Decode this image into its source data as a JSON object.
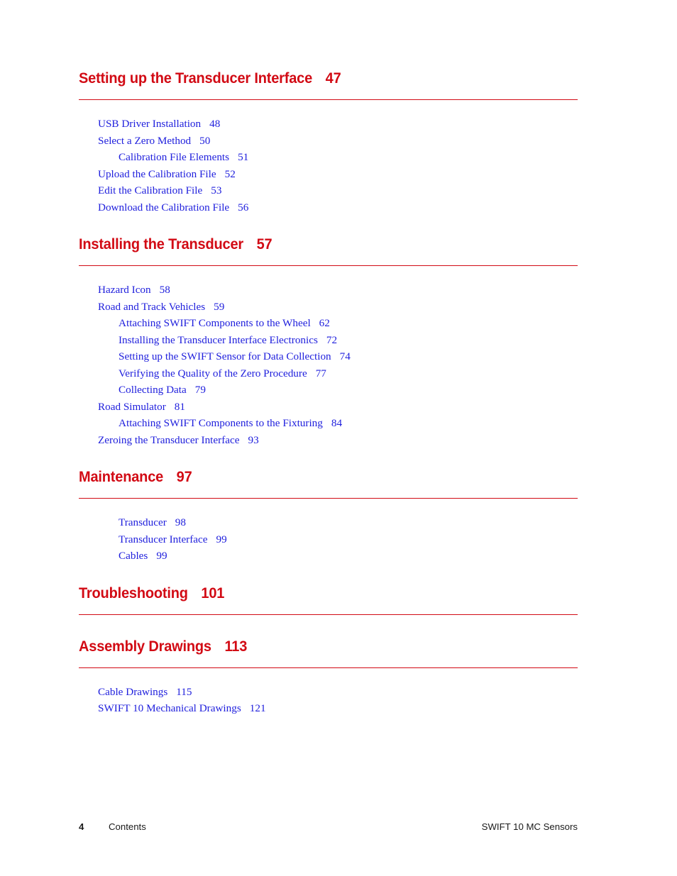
{
  "document": {
    "colors": {
      "heading_red": "#d20a14",
      "entry_blue": "#2020dd",
      "footer_text": "#1a1a1a",
      "background": "#ffffff"
    }
  },
  "toc": {
    "sections": [
      {
        "title": "Setting up the Transducer Interface",
        "page": "47",
        "entries": [
          {
            "label": "USB Driver Installation",
            "page": "48",
            "level": 1
          },
          {
            "label": "Select a Zero Method",
            "page": "50",
            "level": 1
          },
          {
            "label": "Calibration File Elements",
            "page": "51",
            "level": 2
          },
          {
            "label": "Upload the Calibration File",
            "page": "52",
            "level": 1
          },
          {
            "label": "Edit the Calibration File",
            "page": "53",
            "level": 1
          },
          {
            "label": "Download the Calibration File",
            "page": "56",
            "level": 1
          }
        ]
      },
      {
        "title": "Installing the Transducer",
        "page": "57",
        "entries": [
          {
            "label": "Hazard Icon",
            "page": "58",
            "level": 1
          },
          {
            "label": "Road and Track Vehicles",
            "page": "59",
            "level": 1
          },
          {
            "label": "Attaching SWIFT Components to the Wheel",
            "page": "62",
            "level": 2
          },
          {
            "label": "Installing the Transducer Interface Electronics",
            "page": "72",
            "level": 2
          },
          {
            "label": "Setting up the SWIFT Sensor for Data Collection",
            "page": "74",
            "level": 2
          },
          {
            "label": "Verifying the Quality of the Zero Procedure",
            "page": "77",
            "level": 2
          },
          {
            "label": "Collecting Data",
            "page": "79",
            "level": 2
          },
          {
            "label": "Road Simulator",
            "page": "81",
            "level": 1
          },
          {
            "label": "Attaching SWIFT Components to the Fixturing",
            "page": "84",
            "level": 2
          },
          {
            "label": "Zeroing the Transducer Interface",
            "page": "93",
            "level": 1
          }
        ]
      },
      {
        "title": "Maintenance",
        "page": "97",
        "entries": [
          {
            "label": "Transducer",
            "page": "98",
            "level": 2
          },
          {
            "label": "Transducer Interface",
            "page": "99",
            "level": 2
          },
          {
            "label": "Cables",
            "page": "99",
            "level": 2
          }
        ]
      },
      {
        "title": "Troubleshooting",
        "page": "101",
        "entries": []
      },
      {
        "title": "Assembly Drawings",
        "page": "113",
        "entries": [
          {
            "label": "Cable Drawings",
            "page": "115",
            "level": 1
          },
          {
            "label": "SWIFT 10 Mechanical Drawings",
            "page": "121",
            "level": 1
          }
        ]
      }
    ]
  },
  "footer": {
    "page_number": "4",
    "left_label": "Contents",
    "right_label": "SWIFT 10 MC Sensors"
  }
}
